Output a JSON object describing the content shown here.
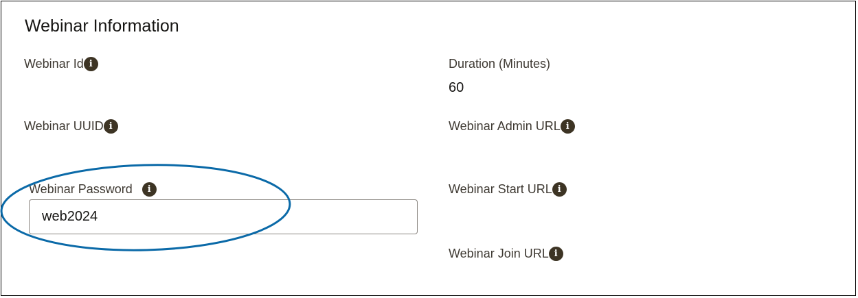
{
  "section": {
    "title": "Webinar Information"
  },
  "fields": {
    "webinar_id": {
      "label": "Webinar Id",
      "info_icon": "info-icon"
    },
    "duration": {
      "label": "Duration (Minutes)",
      "value": "60"
    },
    "webinar_uuid": {
      "label": "Webinar UUID",
      "info_icon": "info-icon"
    },
    "admin_url": {
      "label": "Webinar Admin URL",
      "info_icon": "info-icon"
    },
    "password": {
      "label": "Webinar Password",
      "value": "web2024",
      "info_icon": "info-icon"
    },
    "start_url": {
      "label": "Webinar Start URL",
      "info_icon": "info-icon"
    },
    "join_url": {
      "label": "Webinar Join URL",
      "info_icon": "info-icon"
    }
  },
  "annotation": {
    "shape": "ellipse",
    "color": "#0b6aa8"
  }
}
